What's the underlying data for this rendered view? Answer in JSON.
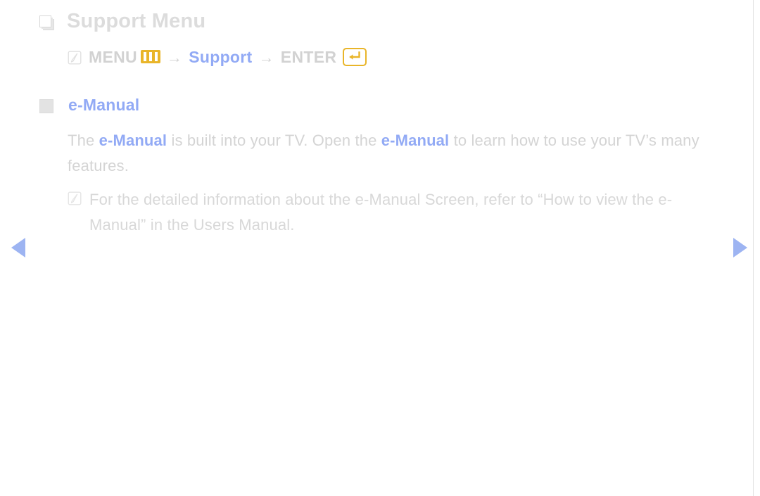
{
  "page": {
    "title": "Support Menu",
    "background_color": "#ffffff"
  },
  "colors": {
    "accent_blue": "#92aaf5",
    "accent_gold": "#e9b529",
    "body_gray": "#d4d4d4",
    "title_gray": "#dcdcdc",
    "arrow_blue": "#9db4f2"
  },
  "menu_path": {
    "note_icon": "note-icon",
    "menu_label": "MENU",
    "menu_key_icon": "menu-key-icon",
    "separator_1": "→",
    "target_label": "Support",
    "separator_2": "→",
    "enter_label": "ENTER",
    "enter_key_icon": "enter-key-icon"
  },
  "section": {
    "bullet_icon": "square-bullet-icon",
    "heading": "e-Manual",
    "paragraph": {
      "part_1": "The ",
      "emphasis_1": "e-Manual",
      "part_2": " is built into your TV. Open the ",
      "emphasis_2": "e-Manual",
      "part_3": " to learn how to use your TV’s many features."
    },
    "note": {
      "icon": "note-icon",
      "text": "For the detailed information about the e-Manual Screen, refer to “How to view the e-Manual” in the Users Manual."
    }
  },
  "navigation": {
    "previous_label": "previous-page-arrow",
    "next_label": "next-page-arrow"
  }
}
